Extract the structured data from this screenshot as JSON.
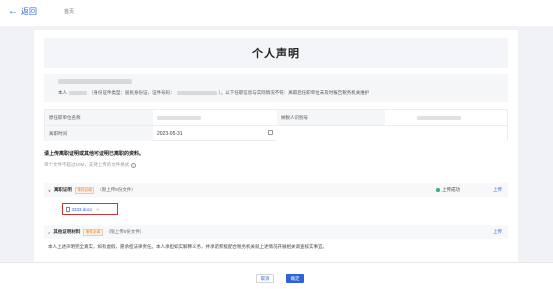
{
  "header": {
    "back_label": "返回",
    "breadcrumb": "首页"
  },
  "page": {
    "title": "个人声明"
  },
  "declaration": {
    "text_part1": "本人",
    "text_part2": "（身份证件类型：",
    "id_type": "居民身份证",
    "text_part3": "，证件号码：",
    "text_part4": "），以下任职信息与实际情况不符：离职后任职单位未及时报告税务机关维护"
  },
  "info_table": {
    "employer_label": "原任职单位名称",
    "taxpayer_id_label": "纳税人识别号",
    "leave_date_label": "离职时间",
    "leave_date_value": "2023-05-31"
  },
  "upload_section": {
    "title": "请上传离职证明或其他可证明已离职的资料。",
    "hint": "单个文件不超过10M，支持上传的文件格式"
  },
  "documents": [
    {
      "title": "离职证明",
      "tag": "条件必填",
      "note": "（限上传5份文件）",
      "status": "上传成功",
      "upload_label": "上传",
      "file": {
        "name": "3333.docx",
        "remove": "×"
      }
    },
    {
      "title": "其他证明材料",
      "tag": "条件必填",
      "note": "（限上传5份文件）",
      "upload_label": "上传"
    }
  ],
  "statement": "本人上述声明完全真实，如有虚假，愿承担法律责任。本人承担如实解释义务，并承诺积极配合税务机关就上述情况开展相关调查核实事宜。",
  "footer": {
    "cancel_label": "取消",
    "confirm_label": "确定"
  },
  "colors": {
    "accent": "#2f64d8",
    "success": "#2bb673",
    "tag": "#e57b24",
    "highlight_border": "#c9383a"
  }
}
